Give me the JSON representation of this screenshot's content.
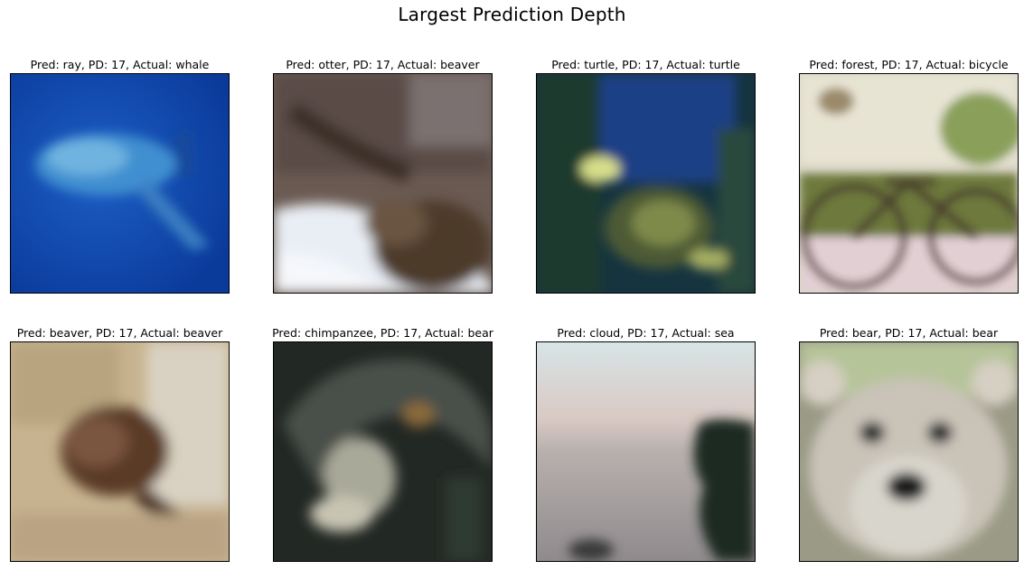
{
  "figure_title": "Largest Prediction Depth",
  "panels": [
    {
      "label": "Pred: ray, PD: 17, Actual: whale",
      "pred": "ray",
      "pd": 17,
      "actual": "whale",
      "scene": "underwater-whale"
    },
    {
      "label": "Pred: otter, PD: 17, Actual: beaver",
      "pred": "otter",
      "pd": 17,
      "actual": "beaver",
      "scene": "beaver-in-snow"
    },
    {
      "label": "Pred: turtle, PD: 17, Actual: turtle",
      "pred": "turtle",
      "pd": 17,
      "actual": "turtle",
      "scene": "sea-turtle"
    },
    {
      "label": "Pred: forest, PD: 17, Actual: bicycle",
      "pred": "forest",
      "pd": 17,
      "actual": "bicycle",
      "scene": "bicycle-with-plants"
    },
    {
      "label": "Pred: beaver, PD: 17, Actual: beaver",
      "pred": "beaver",
      "pd": 17,
      "actual": "beaver",
      "scene": "beaver-on-rocks"
    },
    {
      "label": "Pred: chimpanzee, PD: 17, Actual: bear",
      "pred": "chimpanzee",
      "pd": 17,
      "actual": "bear",
      "scene": "dark-animal-close-up"
    },
    {
      "label": "Pred: cloud, PD: 17, Actual: sea",
      "pred": "cloud",
      "pd": 17,
      "actual": "sea",
      "scene": "hazy-sea-with-tree"
    },
    {
      "label": "Pred: bear, PD: 17, Actual: bear",
      "pred": "bear",
      "pd": 17,
      "actual": "bear",
      "scene": "bear-face"
    }
  ]
}
